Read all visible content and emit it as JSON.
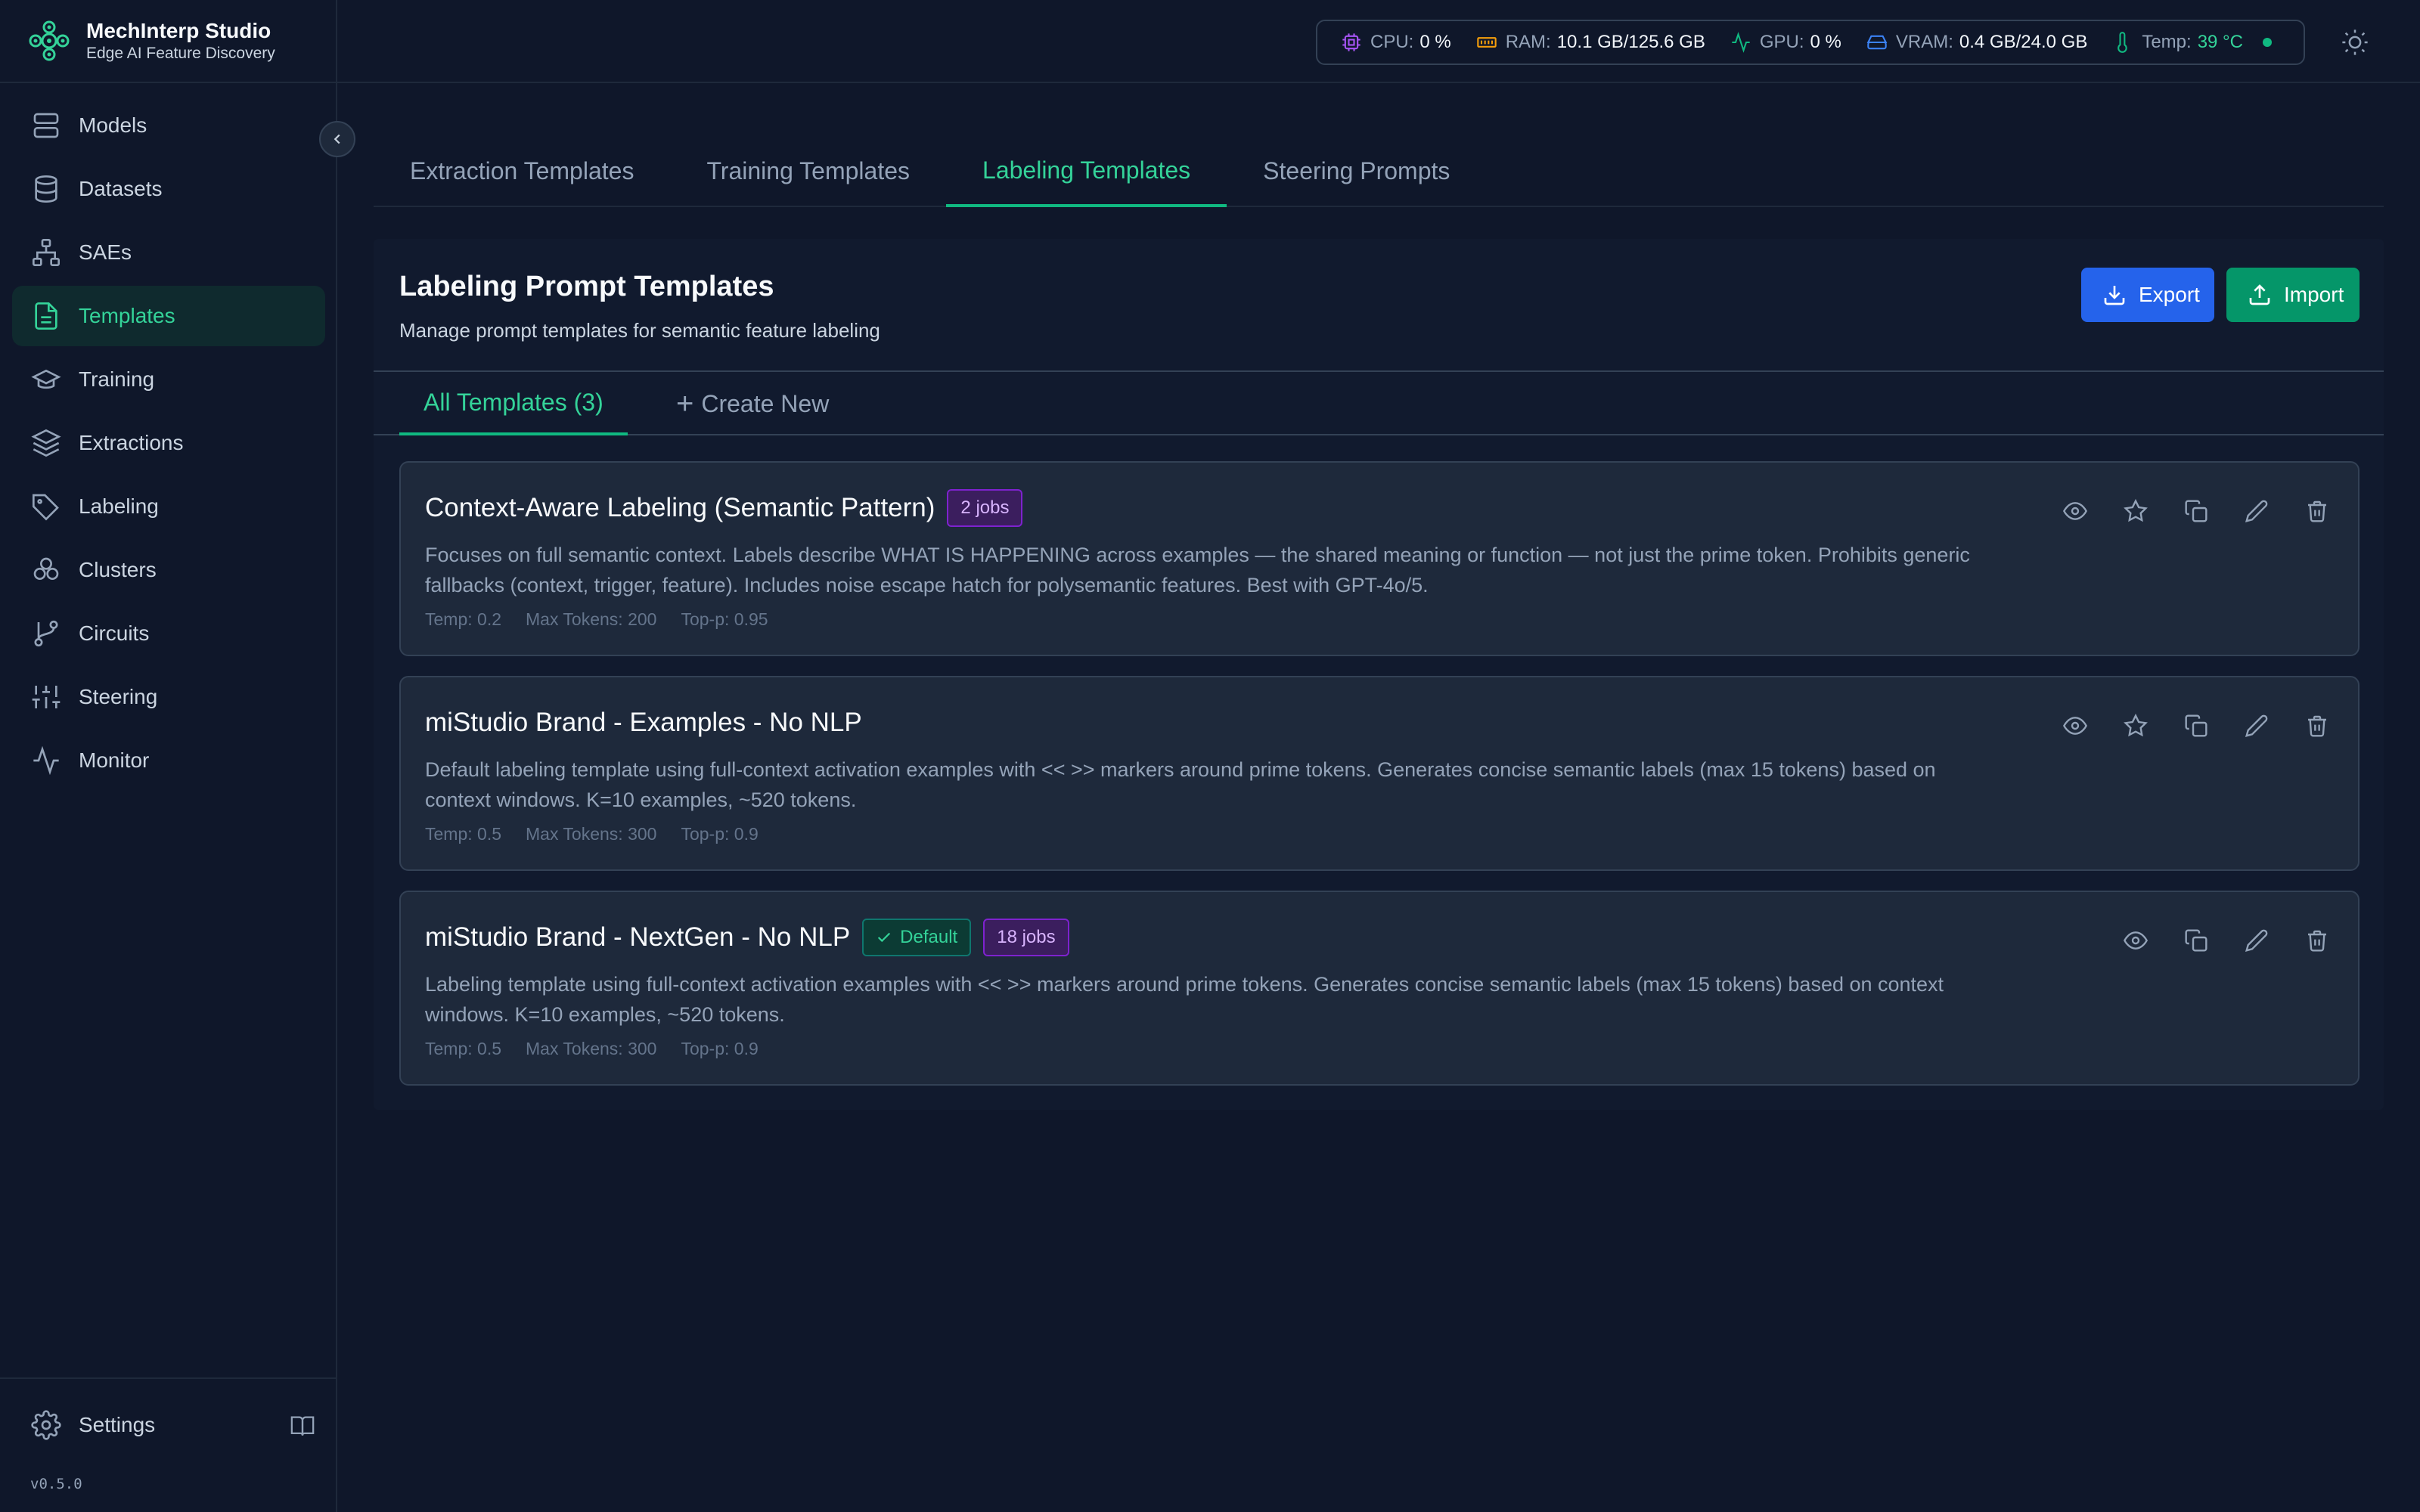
{
  "app": {
    "name": "MechInterp Studio",
    "tagline": "Edge AI Feature Discovery",
    "version": "v0.5.0"
  },
  "sidebar": {
    "items": [
      {
        "label": "Models",
        "icon": "server-icon"
      },
      {
        "label": "Datasets",
        "icon": "database-icon"
      },
      {
        "label": "SAEs",
        "icon": "network-icon"
      },
      {
        "label": "Templates",
        "icon": "file-text-icon",
        "active": true
      },
      {
        "label": "Training",
        "icon": "graduation-cap-icon"
      },
      {
        "label": "Extractions",
        "icon": "layers-icon"
      },
      {
        "label": "Labeling",
        "icon": "tag-icon"
      },
      {
        "label": "Clusters",
        "icon": "clusters-icon"
      },
      {
        "label": "Circuits",
        "icon": "git-branch-icon"
      },
      {
        "label": "Steering",
        "icon": "sliders-icon"
      },
      {
        "label": "Monitor",
        "icon": "activity-icon"
      }
    ],
    "settings_label": "Settings"
  },
  "metrics": {
    "cpu": {
      "label": "CPU:",
      "value": "0 %"
    },
    "ram": {
      "label": "RAM:",
      "value": "10.1 GB/125.6 GB"
    },
    "gpu": {
      "label": "GPU:",
      "value": "0 %"
    },
    "vram": {
      "label": "VRAM:",
      "value": "0.4 GB/24.0 GB"
    },
    "temp": {
      "label": "Temp:",
      "value": "39 °C"
    }
  },
  "tabs": [
    "Extraction Templates",
    "Training Templates",
    "Labeling Templates",
    "Steering Prompts"
  ],
  "panel": {
    "title": "Labeling Prompt Templates",
    "subtitle": "Manage prompt templates for semantic feature labeling",
    "export_label": "Export",
    "import_label": "Import",
    "subtab_all": "All Templates (3)",
    "subtab_create": "Create New"
  },
  "templates": [
    {
      "title": "Context-Aware Labeling (Semantic Pattern)",
      "jobs": "2 jobs",
      "description": "Focuses on full semantic context. Labels describe WHAT IS HAPPENING across examples — the shared meaning or function — not just the prime token. Prohibits generic fallbacks (context, trigger, feature). Includes noise escape hatch for polysemantic features. Best with GPT-4o/5.",
      "temp": "Temp: 0.2",
      "max_tokens": "Max Tokens: 200",
      "top_p": "Top-p: 0.95"
    },
    {
      "title": "miStudio Brand - Examples - No NLP",
      "description": "Default labeling template using full-context activation examples with << >> markers around prime tokens. Generates concise semantic labels (max 15 tokens) based on context windows. K=10 examples, ~520 tokens.",
      "temp": "Temp: 0.5",
      "max_tokens": "Max Tokens: 300",
      "top_p": "Top-p: 0.9"
    },
    {
      "title": "miStudio Brand - NextGen - No NLP",
      "default_label": "Default",
      "jobs": "18 jobs",
      "description": "Labeling template using full-context activation examples with << >> markers around prime tokens. Generates concise semantic labels (max 15 tokens) based on context windows. K=10 examples, ~520 tokens.",
      "temp": "Temp: 0.5",
      "max_tokens": "Max Tokens: 300",
      "top_p": "Top-p: 0.9"
    }
  ],
  "colors": {
    "accent": "#34d399",
    "export": "#2563eb",
    "import": "#059669",
    "jobs_badge": "#7e22ce"
  }
}
